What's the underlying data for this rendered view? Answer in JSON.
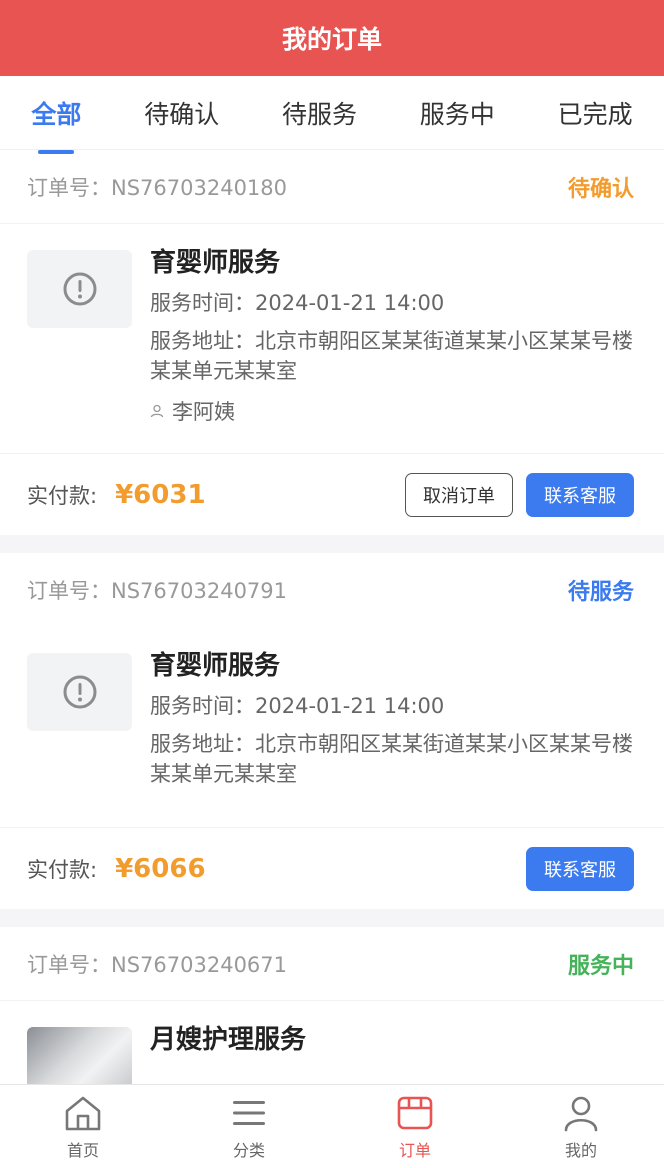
{
  "header": {
    "title": "我的订单"
  },
  "tabs": [
    {
      "label": "全部",
      "active": true
    },
    {
      "label": "待确认"
    },
    {
      "label": "待服务"
    },
    {
      "label": "服务中"
    },
    {
      "label": "已完成"
    }
  ],
  "orders": [
    {
      "order_no": "订单号：NS76703240180",
      "status": "待确认",
      "service_name": "育婴师服务",
      "time": "服务时间：2024-01-21 14:00",
      "address": "服务地址：北京市朝阳区某某街道某某小区某某号楼某某单元某某室",
      "person": "李阿姨",
      "pay_label": "实付款:",
      "amount": "¥6031",
      "cancel_label": "取消订单",
      "contact_label": "联系客服"
    },
    {
      "order_no": "订单号：NS76703240791",
      "status": "待服务",
      "service_name": "育婴师服务",
      "time": "服务时间：2024-01-21 14:00",
      "address": "服务地址：北京市朝阳区某某街道某某小区某某号楼某某单元某某室",
      "pay_label": "实付款:",
      "amount": "¥6066",
      "contact_label": "联系客服"
    },
    {
      "order_no": "订单号：NS76703240671",
      "status": "服务中",
      "service_name": "月嫂护理服务"
    }
  ],
  "tabbar": [
    {
      "label": "首页",
      "icon": "home-icon"
    },
    {
      "label": "分类",
      "icon": "menu-icon"
    },
    {
      "label": "订单",
      "icon": "order-icon",
      "active": true
    },
    {
      "label": "我的",
      "icon": "user-icon"
    }
  ],
  "colors": {
    "brand_red": "#e85451",
    "accent_blue": "#3b7bef",
    "price_orange": "#f39c2e",
    "status_green": "#46b35a"
  }
}
